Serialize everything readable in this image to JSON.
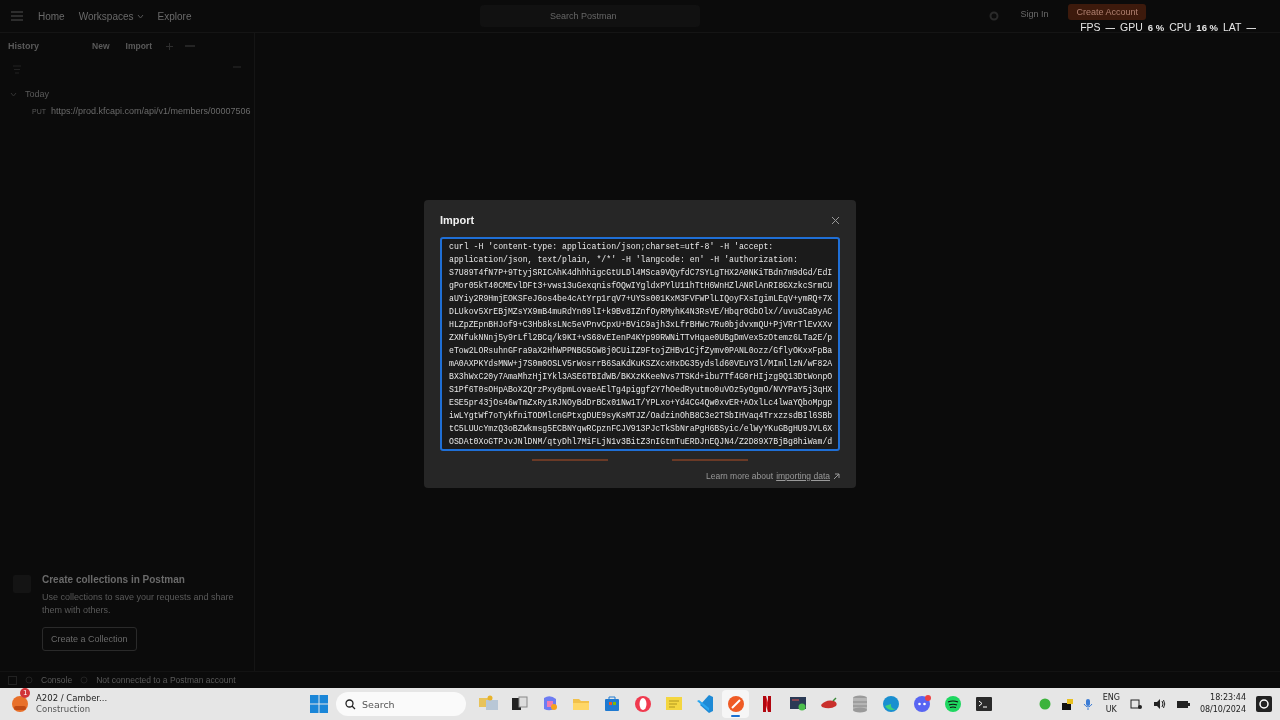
{
  "topbar": {
    "nav": [
      {
        "label": "Home",
        "caret": false
      },
      {
        "label": "Workspaces",
        "caret": true
      },
      {
        "label": "Explore",
        "caret": false
      }
    ],
    "search": {
      "placeholder": "Search Postman"
    },
    "sign_in": "Sign In",
    "create_account": "Create Account"
  },
  "overlay": {
    "items": [
      {
        "label": "FPS",
        "value": "—"
      },
      {
        "label": "GPU",
        "value": "6 %"
      },
      {
        "label": "CPU",
        "value": "16 %"
      },
      {
        "label": "LAT",
        "value": "—"
      }
    ]
  },
  "sidebar": {
    "title": "History",
    "actions": [
      "New",
      "Import"
    ],
    "groups": [
      {
        "label": "Today",
        "expanded": true,
        "children": [
          {
            "method": "PUT",
            "url": "https://prod.kfcapi.com/api/v1/members/00007506"
          }
        ]
      }
    ],
    "empty_state": {
      "title": "Create collections in Postman",
      "text": "Use collections to save your requests and share them with others.",
      "button": "Create a Collection"
    }
  },
  "status_bar": {
    "items": [
      "Console",
      "Not connected to a Postman account"
    ]
  },
  "dialog": {
    "title": "Import",
    "input": {
      "value": "curl -H 'content-type: application/json;charset=utf-8' -H 'accept:\napplication/json, text/plain, */*' -H 'langcode: en' -H 'authorization:\nS7U89T4fN7P+9TtyjSRICAhK4dhhhigcGtULDl4MSca9VQyfdC7SYLgTHX2A0NKiTBdn7m9dGd/EdI\ngPor05kT40CMEvlDFt3+vws13uGexqnisfOQwIYgldxPYlU11hTtH6WnHZlANRlAnRI8GXzkcSrmCU\naUYiy2R9HmjEOKSFeJ6os4be4cAtYrp1rqV7+UYSs001KxM3FVFWPlLIQoyFXsIgimLEqV+ymRQ+7X\nDLUkov5XrEBjMZsYX9mB4muRdYn09lI+k9Bv8IZnfOyRMyhK4N3RsVE/Hbqr0GbOlx//uvu3Ca9yAC\nHLZpZEpnBHJof9+C3Hb8ksLNc5eVPnvCpxU+BViC9ajh3xLfrBHWc7Ru0bjdvxmQU+PjVRrTlEvXXv\nZXNfukNNnj5y9rLfl2BCq/k9KI+vS68vEIenP4KYp99RWNiTTvHqae0UBgDmVex5zOtemz6LTa2E/p\neTow2LORsuhnGFra9aX2HhWPPNBG5GW8j0CUiIZ9FtojZHBv1CjfZymv0PANL0ozz/GflyOKxxFpBa\nmA0AXPKYdsMNW+j7S0m0OSLV5rWosrrB6SaKdKuKSZXcxHxDG35ydsld60VEuY3l/MImllzN/wF82A\nBX3hWxC20y7AmaMhzHjIYkl3ASE6TBIdWB/BKXzKKeeNvs7TSKd+ibu7Tf4G0rHIjzg9Q13DtWonpO\nS1Pf6T0sOHpABoX2QrzPxy8pmLovaeAElTg4piggf2Y7hOedRyutmo0uVOz5yOgmO/NVYPaY5j3qHX\nESE5pr43jOs46wTmZxRy1RJNOyBdDrBCx01Nw1T/YPLxo+Yd4CG4Qw0xvER+AOxlLc4lwaYQboMpgp\niwLYgtWf7oTykfniTODMlcnGPtxgDUE9syKsMTJZ/OadzinOhB8C3e2TSbIHVaq4TrxzzsdBIl6SBb\ntC5LUUcYmzQ3oBZWkmsg5ECBNYqwRCpznFCJV913PJcTkSbNraPgH6BSyic/elWyYKuGBgHU9JVL6X\nOSDAt0XoGTPJvJNlDNM/qtyDhl7MiFLjN1v3BitZ3nIGtmTuERDJnEQJN4/Z2D89X7BjBg8hiWam/d"
    },
    "help": "Learn more about",
    "link": "importing data"
  },
  "taskbar": {
    "weather": {
      "badge": "1",
      "title": "A202 / Camber...",
      "subtitle": "Construction"
    },
    "search": {
      "placeholder": "Search"
    },
    "apps": [
      {
        "kind": "widgets",
        "active": false
      },
      {
        "kind": "taskview",
        "active": false
      },
      {
        "kind": "copilot",
        "active": false
      },
      {
        "kind": "folder",
        "active": false
      },
      {
        "kind": "store",
        "active": false
      },
      {
        "kind": "opera",
        "active": false
      },
      {
        "kind": "notes",
        "active": false
      },
      {
        "kind": "vscode",
        "active": false
      },
      {
        "kind": "postman",
        "active": true
      },
      {
        "kind": "netflix",
        "active": false
      },
      {
        "kind": "monitor",
        "active": false
      },
      {
        "kind": "pepper",
        "active": false
      },
      {
        "kind": "database",
        "active": false
      },
      {
        "kind": "edge",
        "active": false
      },
      {
        "kind": "discord",
        "active": false
      },
      {
        "kind": "spotify",
        "active": false
      },
      {
        "kind": "terminal",
        "active": false
      }
    ],
    "tray": {
      "language": "ENG",
      "region": "UK",
      "time": "18:23:44",
      "date": "08/10/2024"
    }
  }
}
